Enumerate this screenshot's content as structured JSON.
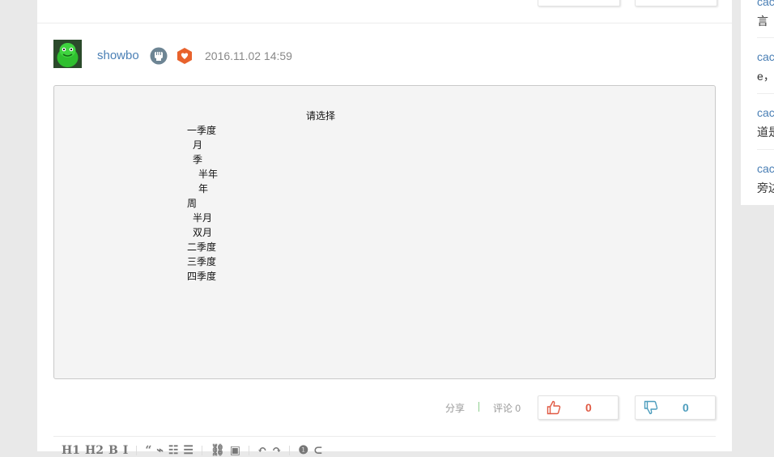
{
  "post": {
    "username": "showbo",
    "date": "2016.11.02 14:59",
    "badges": [
      "fist-badge-icon",
      "heart-hand-badge-icon"
    ]
  },
  "code_block": {
    "lines": [
      "请选择",
      "一季度",
      "月",
      "季",
      "半年",
      "年",
      "周",
      "半月",
      "双月",
      "二季度",
      "三季度",
      "四季度"
    ]
  },
  "footer": {
    "share_label": "分享",
    "comments_label": "评论 0",
    "upvote_count": "0",
    "downvote_count": "0"
  },
  "toolbar": {
    "items": [
      "H1",
      "H2",
      "B",
      "I",
      "“",
      "⌁",
      "☷",
      "☰",
      "⛓",
      "▣",
      "↶",
      "↷",
      "❶",
      "⊂"
    ]
  },
  "sidebar": {
    "items": [
      {
        "link": "cac",
        "text": "言"
      },
      {
        "link": "cac",
        "text": "e，"
      },
      {
        "link": "cac",
        "text": "道是"
      },
      {
        "link": "cac",
        "text": "旁边"
      }
    ]
  },
  "colors": {
    "link": "#4a7fb5",
    "upvote": "#e05a44",
    "downvote": "#4d9dbd",
    "code_bg": "#f4f4f4"
  }
}
